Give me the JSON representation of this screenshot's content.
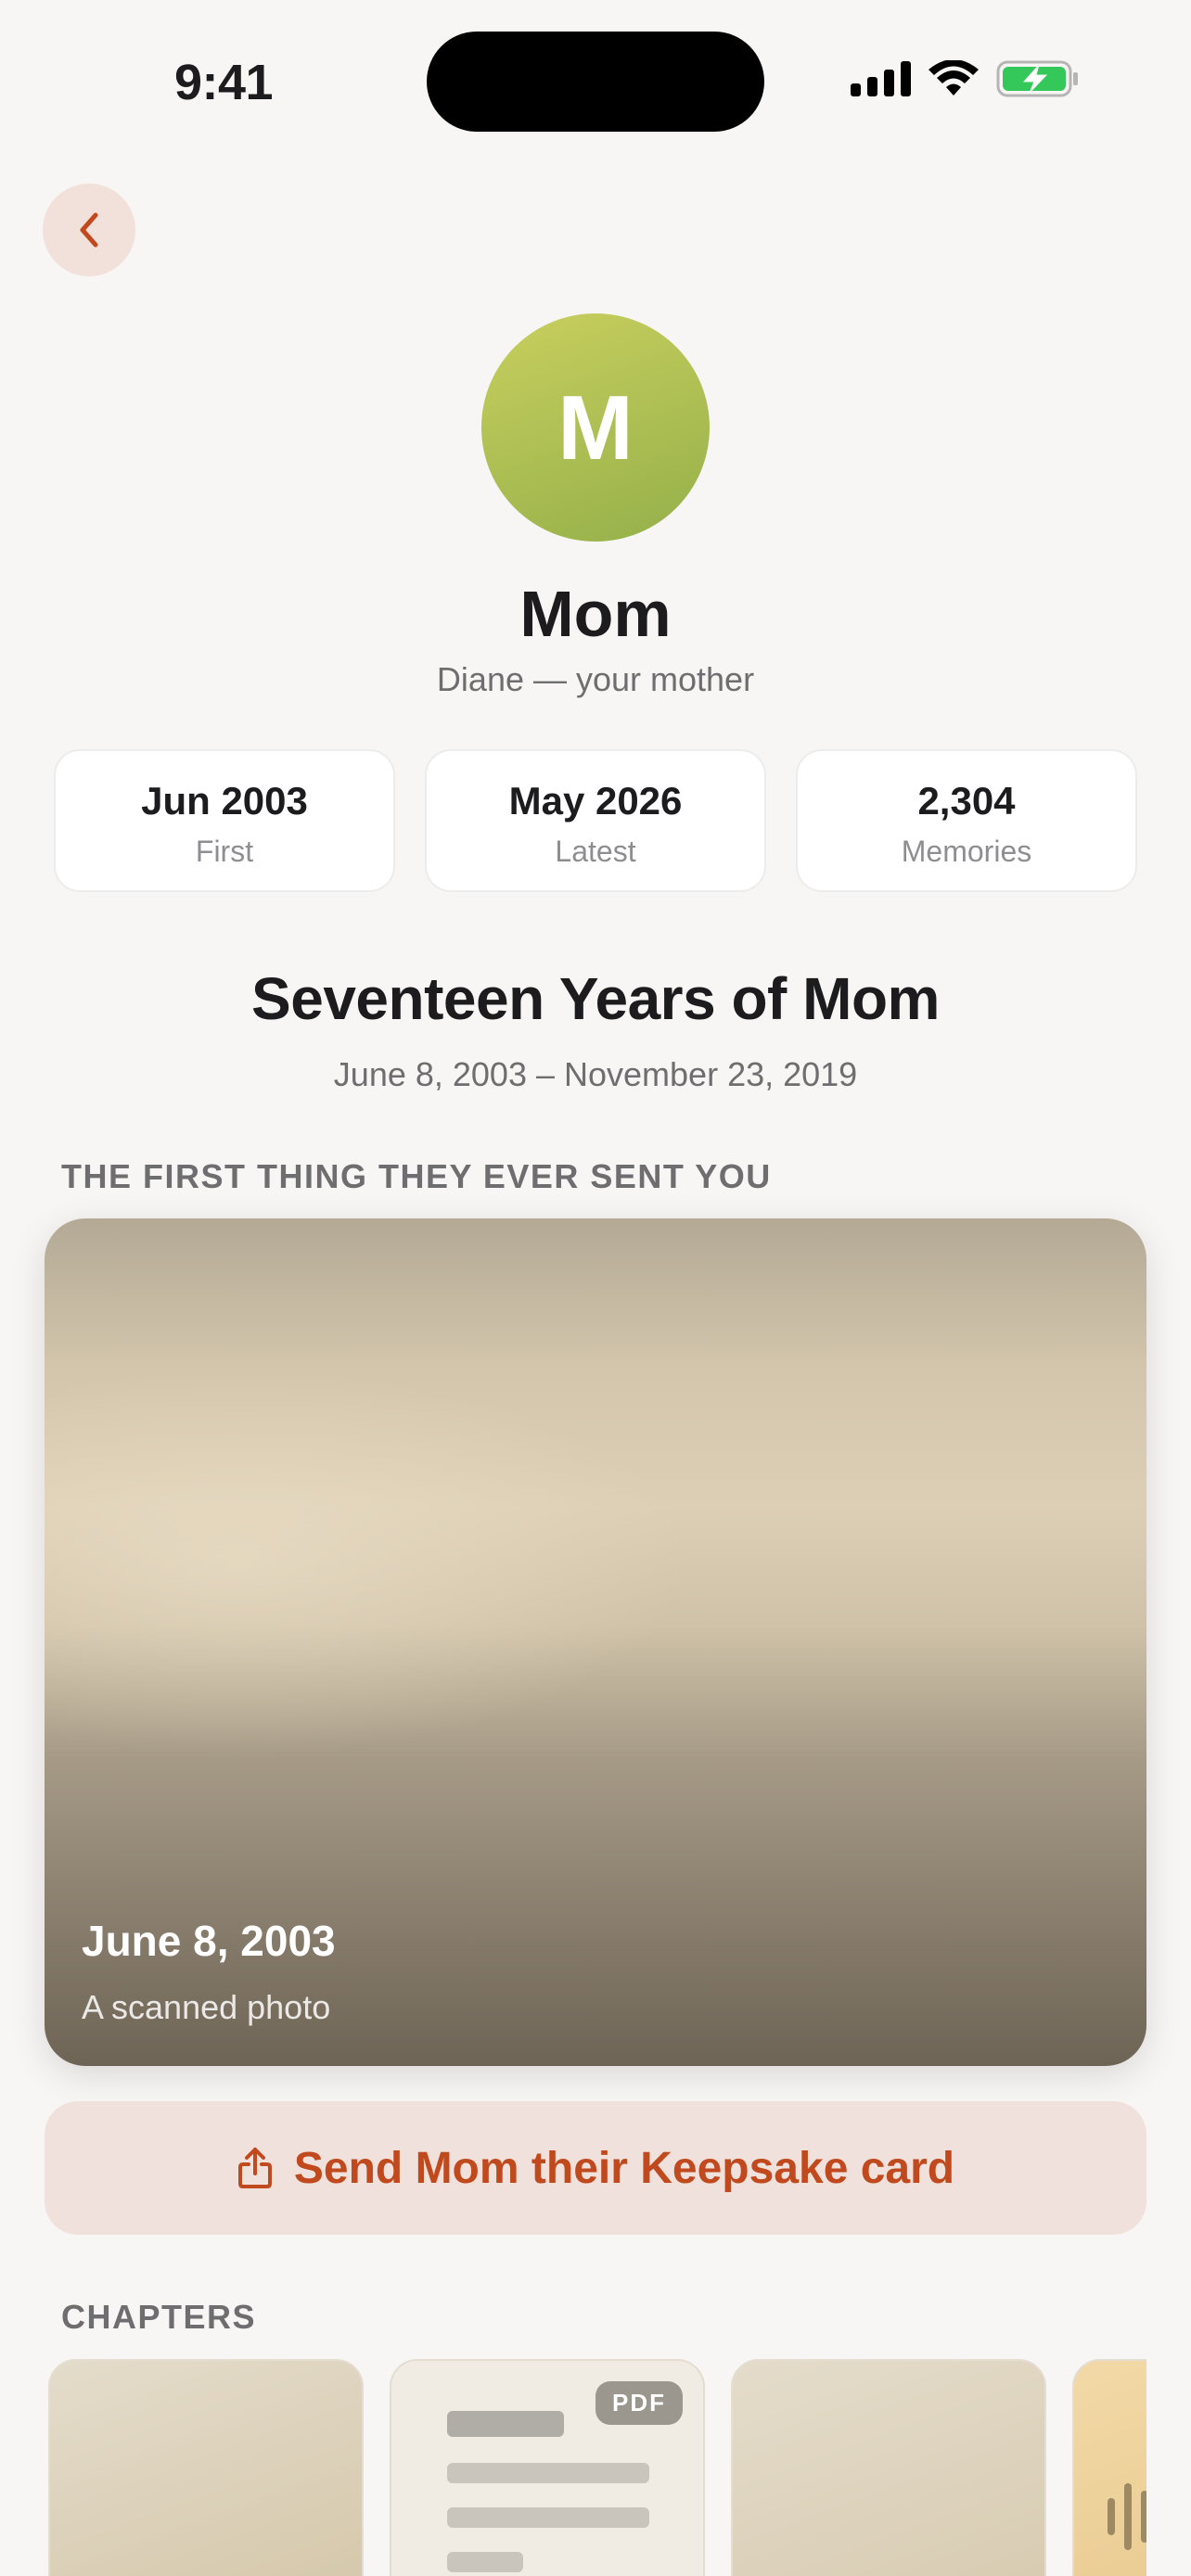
{
  "status_bar": {
    "time": "9:41"
  },
  "profile": {
    "initial": "M",
    "name": "Mom",
    "relation": "Diane — your mother"
  },
  "stats": [
    {
      "value": "Jun 2003",
      "label": "First"
    },
    {
      "value": "May 2026",
      "label": "Latest"
    },
    {
      "value": "2,304",
      "label": "Memories"
    }
  ],
  "story": {
    "title": "Seventeen Years of Mom",
    "range": "June 8, 2003 – November 23, 2019"
  },
  "first_memory": {
    "section_label": "THE FIRST THING THEY EVER SENT YOU",
    "date": "June 8, 2003",
    "description": "A scanned photo"
  },
  "keepsake": {
    "label": "Send Mom their Keepsake card"
  },
  "chapters": {
    "section_label": "CHAPTERS",
    "pdf_badge": "PDF"
  },
  "colors": {
    "accent": "#c0491e",
    "accent_bg": "#f1e1dc",
    "avatar_start": "#c9cf5e",
    "avatar_end": "#94b04a",
    "battery": "#34c759"
  },
  "icons": {
    "back": "chevron-left-icon",
    "share": "share-icon",
    "signal": "cellular-signal-icon",
    "wifi": "wifi-icon",
    "battery": "battery-charging-icon"
  }
}
